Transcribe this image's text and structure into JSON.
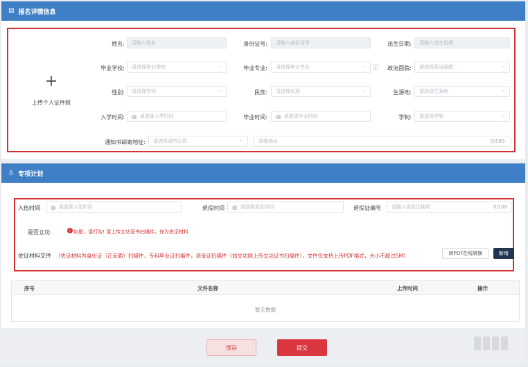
{
  "section1": {
    "title": "报名详情信息",
    "upload_label": "上传个人证件照",
    "fields": {
      "name": {
        "label": "姓名:",
        "placeholder": "请输入姓名"
      },
      "id_number": {
        "label": "身份证号:",
        "placeholder": "请输入身份证号"
      },
      "birth_date": {
        "label": "出生日期:",
        "placeholder": "请输入出生日期"
      },
      "school": {
        "label": "毕业学校:",
        "placeholder": "请选择毕业学校"
      },
      "major": {
        "label": "毕业专业:",
        "placeholder": "请选择毕业专业"
      },
      "politics": {
        "label": "政治面貌:",
        "placeholder": "请选择政治面貌"
      },
      "gender": {
        "label": "性别:",
        "placeholder": "请选择性别"
      },
      "ethnicity": {
        "label": "民族:",
        "placeholder": "请选择民族"
      },
      "origin": {
        "label": "生源地:",
        "placeholder": "请选择生源地"
      },
      "enroll_time": {
        "label": "入学时间:",
        "placeholder": "请选择入学时间"
      },
      "grad_time": {
        "label": "毕业时间:",
        "placeholder": "请选择毕业时间"
      },
      "schooling": {
        "label": "学制:",
        "placeholder": "请选择学制"
      },
      "address": {
        "label": "通知书邮寄地址:",
        "placeholder": "请选择省市区县",
        "detail_placeholder": "详细地址",
        "counter": "0/100"
      }
    }
  },
  "section2": {
    "title": "专项计划",
    "enlist_time": {
      "label": "入伍时间",
      "placeholder": "请选择入伍时间"
    },
    "retire_time": {
      "label": "退役时间",
      "placeholder": "请选择退役时间"
    },
    "retire_cert": {
      "label": "退役证编号",
      "placeholder": "请输入退役证编号",
      "counter": "0/100"
    },
    "merit": {
      "label": "是否立功",
      "note": "如是，请打勾! 请上传立功证书扫描件，作为佐证材料"
    },
    "materials": {
      "label": "佐证材料文件",
      "desc": "（佐证材料为身份证（正反面）扫描件，专科毕业证扫描件，退役证扫描件（如立功则上传立功证书扫描件），文件仅支持上传PDF格式，大小不超过5M）",
      "convert_button": "转PDF在线转换",
      "add_button": "新增"
    },
    "table": {
      "columns": [
        "序号",
        "文件名称",
        "上传时间",
        "操作"
      ],
      "empty": "暂无数据"
    }
  },
  "footer": {
    "save_button": "保存",
    "submit_button": "提交"
  },
  "colors": {
    "header": "#3f7fc5",
    "highlight": "#d33131",
    "submit": "#d9363e"
  }
}
